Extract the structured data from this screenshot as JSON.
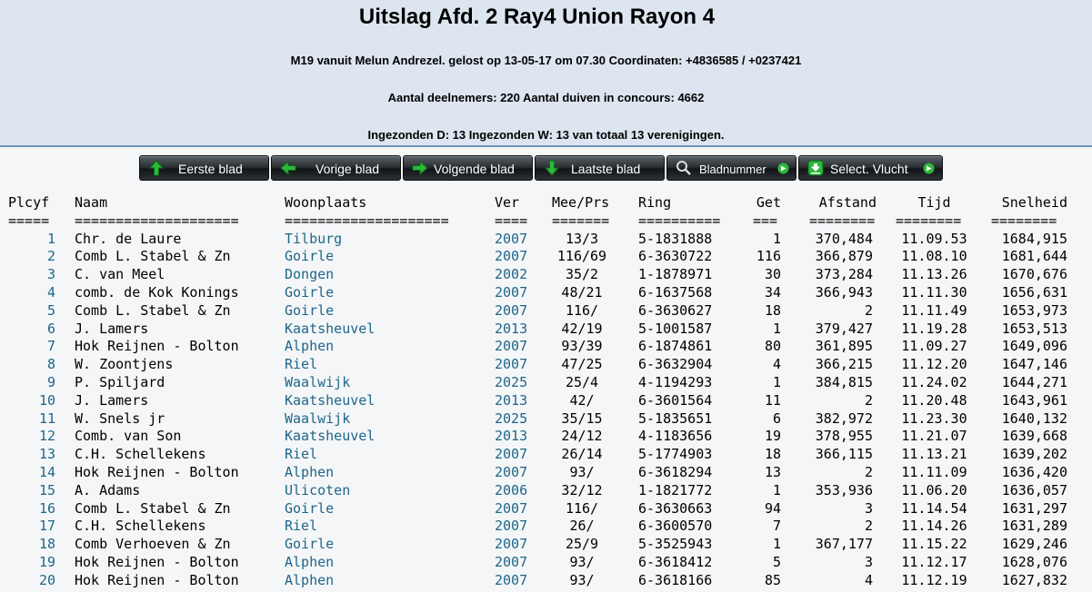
{
  "header": {
    "title": "Uitslag Afd. 2 Ray4 Union Rayon 4",
    "race_info": "M19 vanuit Melun Andrezel. gelost op 13-05-17 om 07.30 Coordinaten: +4836585 / +0237421",
    "participants": "Aantal deelnemers: 220 Aantal duiven in concours: 4662",
    "submitted": "Ingezonden D: 13 Ingezonden W: 13 van totaal 13 verenigingen."
  },
  "nav": {
    "first": "Eerste blad",
    "prev": "Vorige blad",
    "next": "Volgende blad",
    "last": "Laatste blad",
    "page": "Bladnummer",
    "select": "Select. Vlucht"
  },
  "colors": {
    "header_bg": "#dde6f0",
    "link": "#1f6688",
    "icon_green": "#2db83a"
  },
  "table": {
    "columns": {
      "plcyf": "Plcyf",
      "naam": "Naam",
      "woonplaats": "Woonplaats",
      "ver": "Ver",
      "meeprs": "Mee/Prs",
      "ring": "Ring",
      "get": "Get",
      "afstand": "Afstand",
      "tijd": "Tijd",
      "snelheid": "Snelheid"
    },
    "separators": {
      "plcyf": "=====",
      "naam": "====================",
      "woonplaats": "====================",
      "ver": "====",
      "meeprs": "=======",
      "ring": "==========",
      "get": "===",
      "afstand": "========",
      "tijd": "========",
      "snelheid": "========"
    },
    "rows": [
      {
        "plcyf": "1",
        "naam": "Chr. de Laure",
        "woonplaats": "Tilburg",
        "ver": "2007",
        "meeprs": "13/3",
        "ring": "5-1831888",
        "get": "1",
        "afstand": "370,484",
        "tijd": "11.09.53",
        "snelheid": "1684,915"
      },
      {
        "plcyf": "2",
        "naam": "Comb L. Stabel & Zn",
        "woonplaats": "Goirle",
        "ver": "2007",
        "meeprs": "116/69",
        "ring": "6-3630722",
        "get": "116",
        "afstand": "366,879",
        "tijd": "11.08.10",
        "snelheid": "1681,644"
      },
      {
        "plcyf": "3",
        "naam": "C. van Meel",
        "woonplaats": "Dongen",
        "ver": "2002",
        "meeprs": "35/2",
        "ring": "1-1878971",
        "get": "30",
        "afstand": "373,284",
        "tijd": "11.13.26",
        "snelheid": "1670,676"
      },
      {
        "plcyf": "4",
        "naam": "comb. de Kok Konings",
        "woonplaats": "Goirle",
        "ver": "2007",
        "meeprs": "48/21",
        "ring": "6-1637568",
        "get": "34",
        "afstand": "366,943",
        "tijd": "11.11.30",
        "snelheid": "1656,631"
      },
      {
        "plcyf": "5",
        "naam": "Comb L. Stabel & Zn",
        "woonplaats": "Goirle",
        "ver": "2007",
        "meeprs": "116/",
        "ring": "6-3630627",
        "get": "18",
        "afstand": "2",
        "tijd": "11.11.49",
        "snelheid": "1653,973"
      },
      {
        "plcyf": "6",
        "naam": "J. Lamers",
        "woonplaats": "Kaatsheuvel",
        "ver": "2013",
        "meeprs": "42/19",
        "ring": "5-1001587",
        "get": "1",
        "afstand": "379,427",
        "tijd": "11.19.28",
        "snelheid": "1653,513"
      },
      {
        "plcyf": "7",
        "naam": "Hok Reijnen - Bolton",
        "woonplaats": "Alphen",
        "ver": "2007",
        "meeprs": "93/39",
        "ring": "6-1874861",
        "get": "80",
        "afstand": "361,895",
        "tijd": "11.09.27",
        "snelheid": "1649,096"
      },
      {
        "plcyf": "8",
        "naam": "W. Zoontjens",
        "woonplaats": "Riel",
        "ver": "2007",
        "meeprs": "47/25",
        "ring": "6-3632904",
        "get": "4",
        "afstand": "366,215",
        "tijd": "11.12.20",
        "snelheid": "1647,146"
      },
      {
        "plcyf": "9",
        "naam": "P. Spiljard",
        "woonplaats": "Waalwijk",
        "ver": "2025",
        "meeprs": "25/4",
        "ring": "4-1194293",
        "get": "1",
        "afstand": "384,815",
        "tijd": "11.24.02",
        "snelheid": "1644,271"
      },
      {
        "plcyf": "10",
        "naam": "J. Lamers",
        "woonplaats": "Kaatsheuvel",
        "ver": "2013",
        "meeprs": "42/",
        "ring": "6-3601564",
        "get": "11",
        "afstand": "2",
        "tijd": "11.20.48",
        "snelheid": "1643,961"
      },
      {
        "plcyf": "11",
        "naam": "W. Snels jr",
        "woonplaats": "Waalwijk",
        "ver": "2025",
        "meeprs": "35/15",
        "ring": "5-1835651",
        "get": "6",
        "afstand": "382,972",
        "tijd": "11.23.30",
        "snelheid": "1640,132"
      },
      {
        "plcyf": "12",
        "naam": "Comb. van Son",
        "woonplaats": "Kaatsheuvel",
        "ver": "2013",
        "meeprs": "24/12",
        "ring": "4-1183656",
        "get": "19",
        "afstand": "378,955",
        "tijd": "11.21.07",
        "snelheid": "1639,668"
      },
      {
        "plcyf": "13",
        "naam": "C.H. Schellekens",
        "woonplaats": "Riel",
        "ver": "2007",
        "meeprs": "26/14",
        "ring": "5-1774903",
        "get": "18",
        "afstand": "366,115",
        "tijd": "11.13.21",
        "snelheid": "1639,202"
      },
      {
        "plcyf": "14",
        "naam": "Hok Reijnen - Bolton",
        "woonplaats": "Alphen",
        "ver": "2007",
        "meeprs": "93/",
        "ring": "6-3618294",
        "get": "13",
        "afstand": "2",
        "tijd": "11.11.09",
        "snelheid": "1636,420"
      },
      {
        "plcyf": "15",
        "naam": "A. Adams",
        "woonplaats": "Ulicoten",
        "ver": "2006",
        "meeprs": "32/12",
        "ring": "1-1821772",
        "get": "1",
        "afstand": "353,936",
        "tijd": "11.06.20",
        "snelheid": "1636,057"
      },
      {
        "plcyf": "16",
        "naam": "Comb L. Stabel & Zn",
        "woonplaats": "Goirle",
        "ver": "2007",
        "meeprs": "116/",
        "ring": "6-3630663",
        "get": "94",
        "afstand": "3",
        "tijd": "11.14.54",
        "snelheid": "1631,297"
      },
      {
        "plcyf": "17",
        "naam": "C.H. Schellekens",
        "woonplaats": "Riel",
        "ver": "2007",
        "meeprs": "26/",
        "ring": "6-3600570",
        "get": "7",
        "afstand": "2",
        "tijd": "11.14.26",
        "snelheid": "1631,289"
      },
      {
        "plcyf": "18",
        "naam": "Comb Verhoeven & Zn",
        "woonplaats": "Goirle",
        "ver": "2007",
        "meeprs": "25/9",
        "ring": "5-3525943",
        "get": "1",
        "afstand": "367,177",
        "tijd": "11.15.22",
        "snelheid": "1629,246"
      },
      {
        "plcyf": "19",
        "naam": "Hok Reijnen - Bolton",
        "woonplaats": "Alphen",
        "ver": "2007",
        "meeprs": "93/",
        "ring": "6-3618412",
        "get": "5",
        "afstand": "3",
        "tijd": "11.12.17",
        "snelheid": "1628,076"
      },
      {
        "plcyf": "20",
        "naam": "Hok Reijnen - Bolton",
        "woonplaats": "Alphen",
        "ver": "2007",
        "meeprs": "93/",
        "ring": "6-3618166",
        "get": "85",
        "afstand": "4",
        "tijd": "11.12.19",
        "snelheid": "1627,832"
      }
    ]
  }
}
